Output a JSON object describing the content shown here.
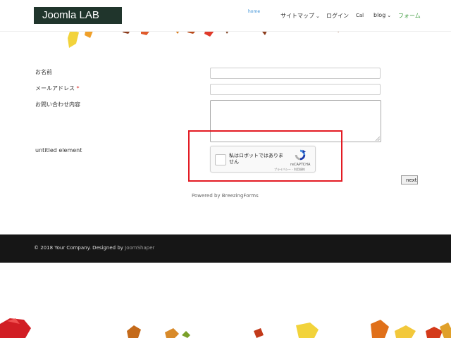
{
  "header": {
    "logo_text": "Joomla LAB",
    "nav": {
      "home": "home",
      "sitemap": "サイトマップ",
      "login": "ログイン",
      "cal": "Cal",
      "blog": "blog",
      "form": "フォーム"
    },
    "colors": {
      "logo_bg": "#20352c",
      "home": "#3a8fd6",
      "form": "#3a9a3a"
    }
  },
  "form": {
    "name_label": "お名前",
    "email_label": "メールアドレス",
    "required_mark": "*",
    "inquiry_label": "お問い合わせ内容",
    "untitled_label": "untitled element",
    "next_button": "next",
    "powered_by": "Powered by BreezingForms"
  },
  "captcha": {
    "text": "私はロボットではありません",
    "brand": "reCAPTCHA",
    "links": "プライバシー - 利用規約"
  },
  "footer": {
    "text": "© 2018 Your Company. Designed by ",
    "link": "JoomShaper"
  },
  "annotation": {
    "highlight_color": "#e31b23"
  }
}
